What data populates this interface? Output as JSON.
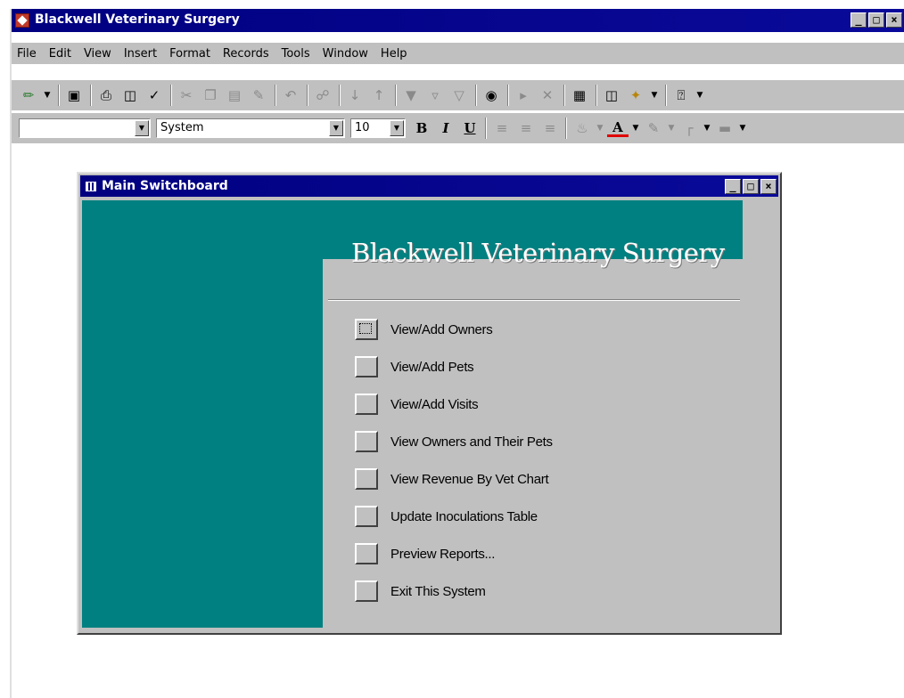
{
  "app": {
    "title": "Blackwell Veterinary Surgery"
  },
  "window_buttons": {
    "minimize": "_",
    "maximize": "□",
    "close": "×"
  },
  "menu": [
    "File",
    "Edit",
    "View",
    "Insert",
    "Format",
    "Records",
    "Tools",
    "Window",
    "Help"
  ],
  "toolbar_icons": [
    "view-icon",
    "save-icon",
    "print-icon",
    "print-preview-icon",
    "spelling-icon",
    "cut-icon",
    "copy-icon",
    "paste-icon",
    "format-painter-icon",
    "undo-icon",
    "hyperlink-icon",
    "sort-ascending-icon",
    "sort-descending-icon",
    "filter-by-selection-icon",
    "filter-by-form-icon",
    "apply-filter-icon",
    "find-icon",
    "new-record-icon",
    "delete-record-icon",
    "properties-icon",
    "database-window-icon",
    "new-object-icon",
    "help-icon"
  ],
  "formatting": {
    "object_value": "",
    "font_name": "System",
    "font_size": "10",
    "bold": "B",
    "italic": "I",
    "underline": "U",
    "font_color_glyph": "A"
  },
  "switchboard": {
    "title": "Main Switchboard",
    "heading": "Blackwell Veterinary Surgery",
    "items": [
      {
        "label": "View/Add Owners"
      },
      {
        "label": "View/Add Pets"
      },
      {
        "label": "View/Add Visits"
      },
      {
        "label": "View Owners and Their Pets"
      },
      {
        "label": "View Revenue By Vet Chart"
      },
      {
        "label": "Update Inoculations Table"
      },
      {
        "label": "Preview Reports..."
      },
      {
        "label": "Exit This System"
      }
    ]
  },
  "colors": {
    "titlebar": "#000080",
    "switchboard_teal": "#008080",
    "chrome": "#c0c0c0"
  }
}
